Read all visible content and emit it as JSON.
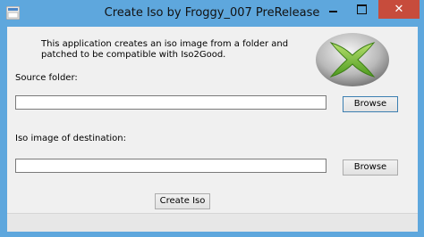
{
  "window": {
    "title": "Create Iso by Froggy_007 PreRelease",
    "controls": {
      "close": "✕"
    }
  },
  "main": {
    "description": "This application creates an iso image from a folder and patched to be compatible with Iso2Good.",
    "source_label": "Source folder:",
    "source_value": "",
    "browse_label": "Browse",
    "dest_label": "Iso image of destination:",
    "dest_value": "",
    "browse2_label": "Browse",
    "create_label": "Create Iso"
  },
  "colors": {
    "frame": "#5ea7dd",
    "close": "#c74c3c",
    "client": "#f0f0f0",
    "logo_green": "#7cc242"
  }
}
